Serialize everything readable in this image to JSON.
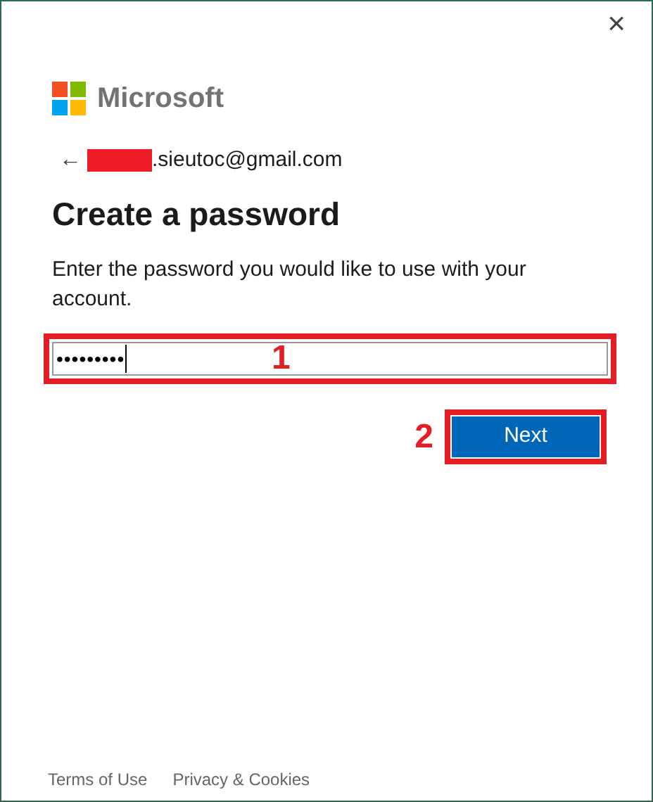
{
  "brand": "Microsoft",
  "close": "×",
  "back": "←",
  "account": {
    "redacted": true,
    "email": ".sieutoc@gmail.com"
  },
  "title": "Create a password",
  "description": "Enter the password you would like to use with your account.",
  "password": {
    "value": "•••••••••"
  },
  "next_button": "Next",
  "annotations": [
    {
      "label": "1"
    },
    {
      "label": "2"
    }
  ],
  "footer_links": [
    "Terms of Use",
    "Privacy & Cookies"
  ]
}
